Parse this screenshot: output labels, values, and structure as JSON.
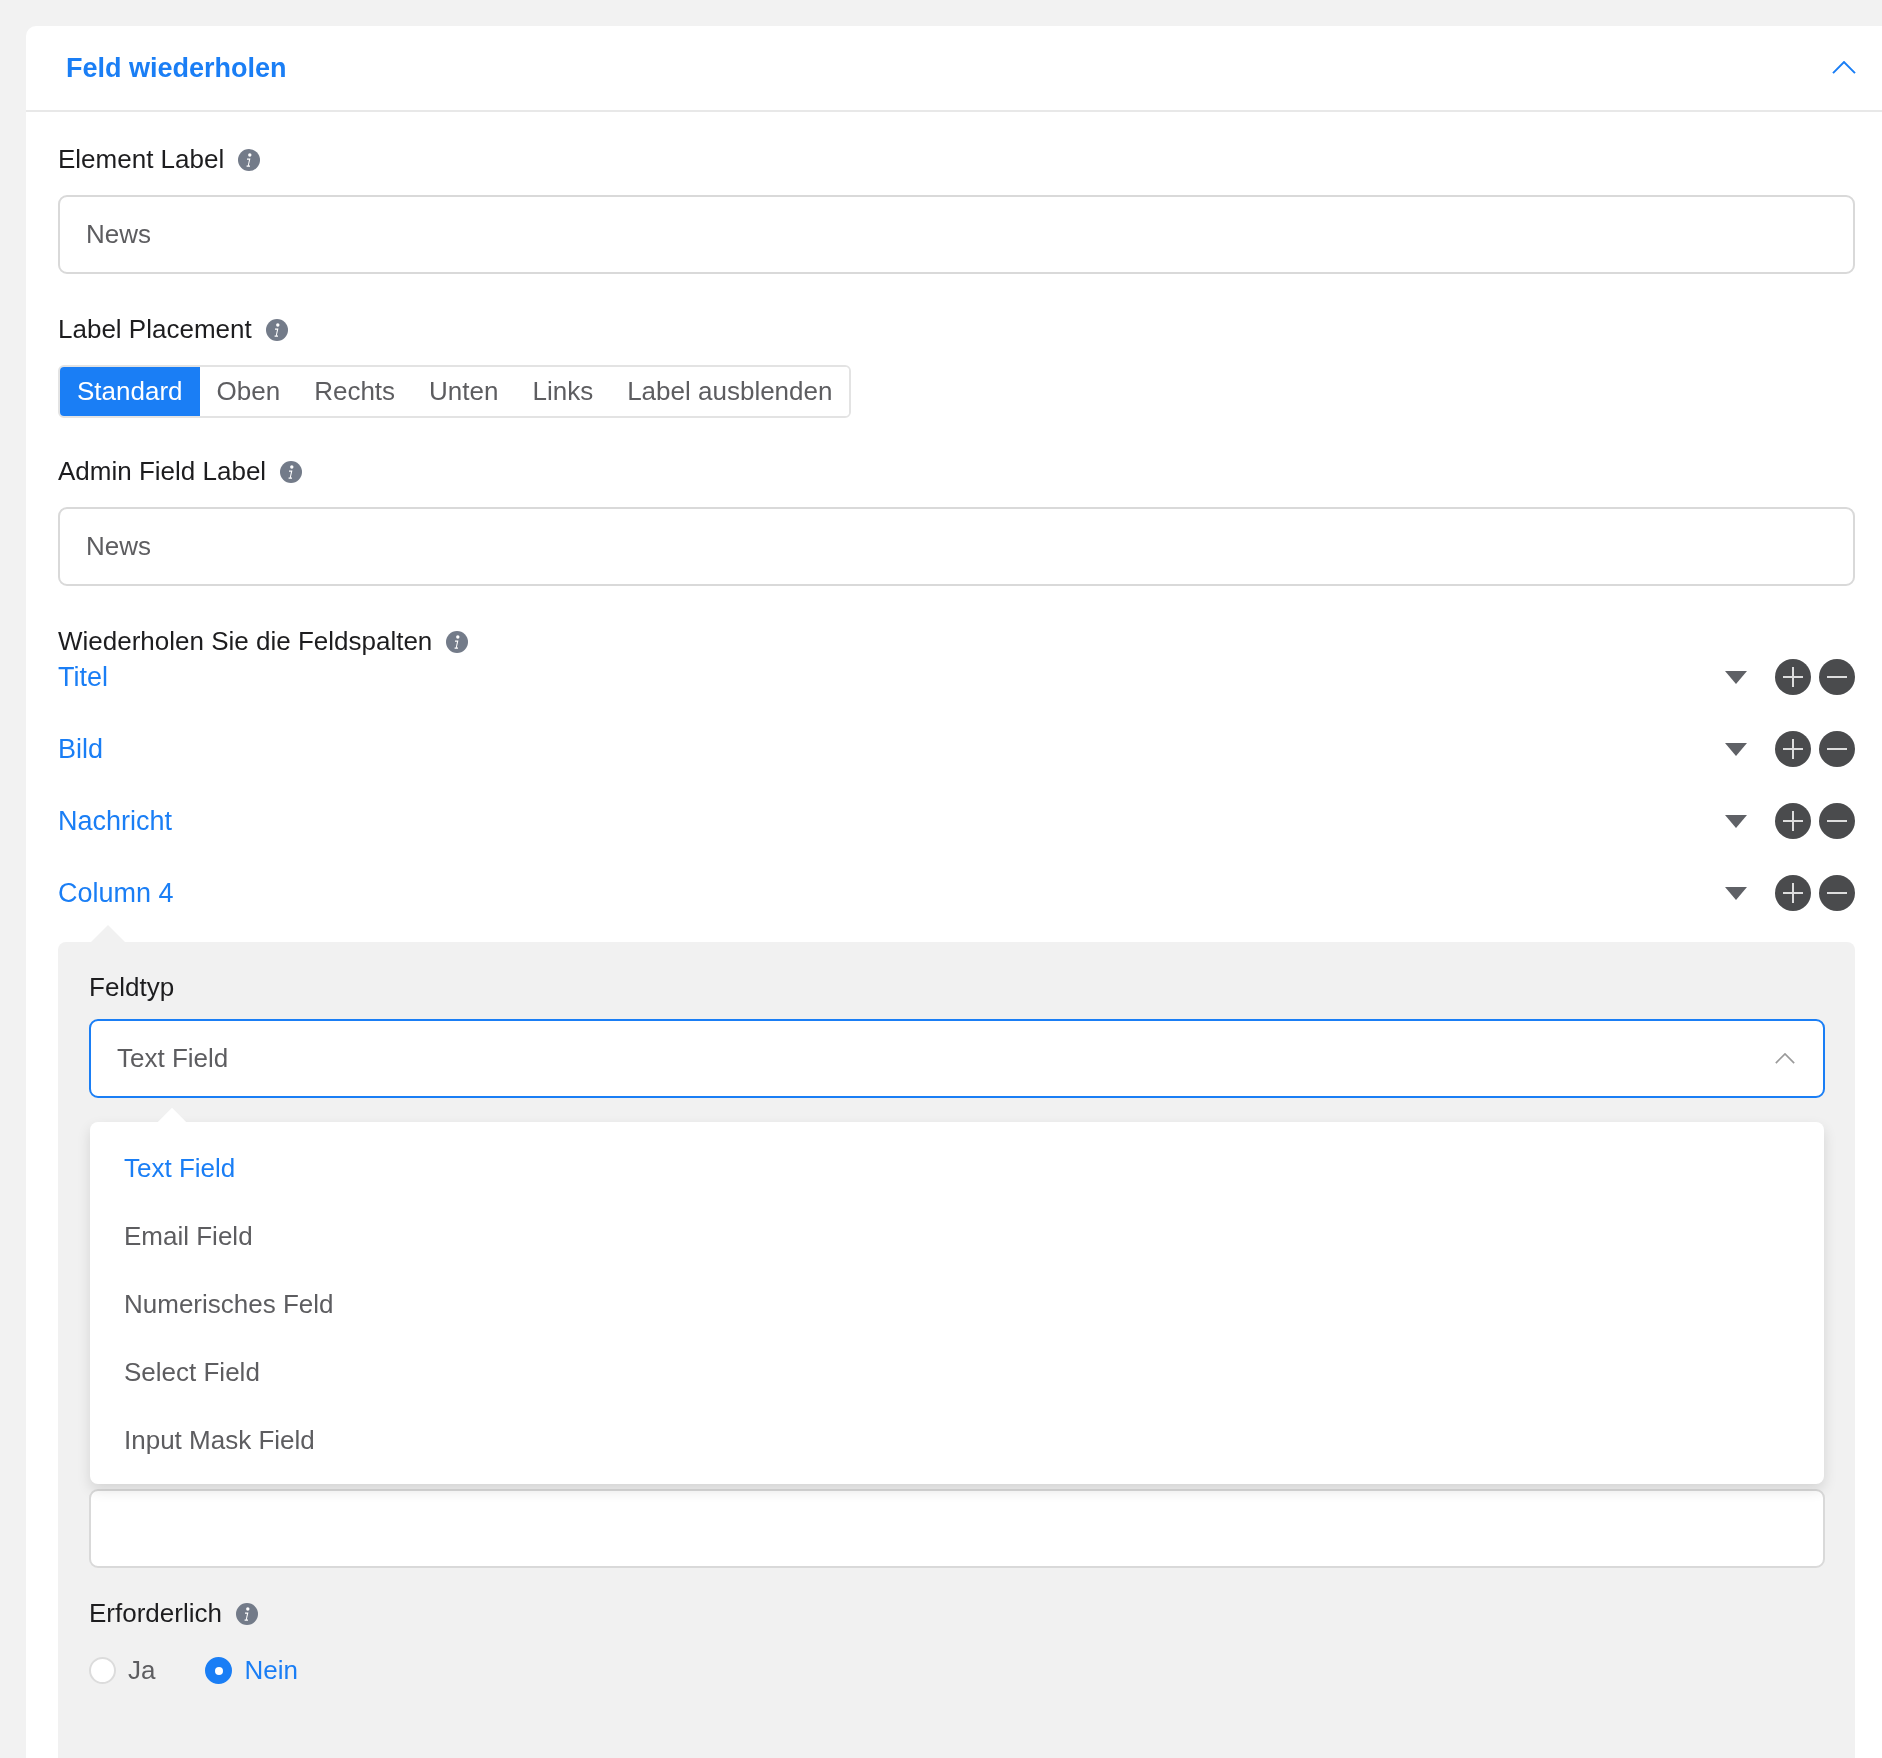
{
  "panel": {
    "title": "Feld wiederholen",
    "expanded": true
  },
  "fields": [
    {
      "kind": "input",
      "label": "Element Label",
      "info": true,
      "value": "News"
    },
    {
      "kind": "segmented",
      "label": "Label Placement",
      "info": true,
      "options": [
        {
          "label": "Standard",
          "selected": true
        },
        {
          "label": "Oben",
          "selected": false
        },
        {
          "label": "Rechts",
          "selected": false
        },
        {
          "label": "Unten",
          "selected": false
        },
        {
          "label": "Links",
          "selected": false
        },
        {
          "label": "Label ausblenden",
          "selected": false
        }
      ]
    },
    {
      "kind": "input",
      "label": "Admin Field Label",
      "info": true,
      "value": "News"
    }
  ],
  "repeater": {
    "label": "Wiederholen Sie die Feldspalten",
    "info": true,
    "columns": [
      {
        "name": "Titel",
        "expanded": false
      },
      {
        "name": "Bild",
        "expanded": false
      },
      {
        "name": "Nachricht",
        "expanded": false
      },
      {
        "name": "Column 4",
        "expanded": true
      }
    ]
  },
  "column_settings": {
    "field_type": {
      "label": "Feldtyp",
      "value": "Text Field",
      "open": true,
      "options": [
        {
          "label": "Text Field",
          "selected": true
        },
        {
          "label": "Email Field",
          "selected": false
        },
        {
          "label": "Numerisches Feld",
          "selected": false
        },
        {
          "label": "Select Field",
          "selected": false
        },
        {
          "label": "Input Mask Field",
          "selected": false
        }
      ]
    },
    "required": {
      "label": "Erforderlich",
      "info": true,
      "options": [
        {
          "label": "Ja",
          "selected": false
        },
        {
          "label": "Nein",
          "selected": true
        }
      ]
    }
  }
}
